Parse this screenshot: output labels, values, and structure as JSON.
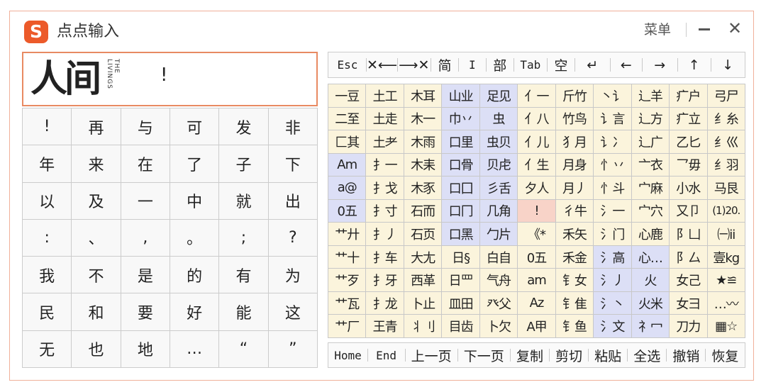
{
  "app": {
    "title": "点点输入",
    "logo": "S",
    "menu_label": "菜单",
    "minimize_label": "–",
    "close_label": "✕"
  },
  "preview": {
    "brand_text": "人间",
    "brand_sub": "THE LIVINGS",
    "mark": "!"
  },
  "left_grid": [
    [
      "!",
      "再",
      "与",
      "可",
      "发",
      "非"
    ],
    [
      "年",
      "来",
      "在",
      "了",
      "子",
      "下"
    ],
    [
      "以",
      "及",
      "一",
      "中",
      "就",
      "出"
    ],
    [
      ":",
      "、",
      ",",
      "。",
      ";",
      "?"
    ],
    [
      "我",
      "不",
      "是",
      "的",
      "有",
      "为"
    ],
    [
      "民",
      "和",
      "要",
      "好",
      "能",
      "这"
    ],
    [
      "无",
      "也",
      "地",
      "…",
      "“",
      "”"
    ]
  ],
  "toolbar_top": [
    "Esc",
    "✕⟵",
    "⟶✕",
    "简",
    "I",
    "部",
    "Tab",
    "空",
    "↵",
    "←",
    "→",
    "↑",
    "↓"
  ],
  "toolbar_bottom": [
    "Home",
    "End",
    "上一页",
    "下一页",
    "复制",
    "剪切",
    "粘贴",
    "全选",
    "撤销",
    "恢复"
  ],
  "right_grid": {
    "cells": [
      [
        "一豆",
        "土工",
        "木耳",
        "山业",
        "足见",
        "亻一",
        "斤竹",
        "丶讠",
        "辶羊",
        "疒户",
        "弓尸"
      ],
      [
        "二至",
        "土走",
        "木一",
        "巾丷",
        "虫",
        "亻八",
        "竹鸟",
        "讠言",
        "辶方",
        "疒立",
        "纟糸"
      ],
      [
        "匚其",
        "土耂",
        "木雨",
        "口里",
        "虫贝",
        "亻儿",
        "犭月",
        "讠冫",
        "辶广",
        "乙匕",
        "纟巛"
      ],
      [
        "Am",
        "扌一",
        "木耒",
        "口骨",
        "贝虍",
        "亻生",
        "月身",
        "忄丷",
        "亠衣",
        "乛毋",
        "纟羽"
      ],
      [
        "a@",
        "扌戈",
        "木豕",
        "口囗",
        "彡舌",
        "夕人",
        "月丿",
        "忄斗",
        "宀麻",
        "小水",
        "马艮"
      ],
      [
        "0五",
        "扌寸",
        "石而",
        "口冂",
        "几角",
        "!",
        "彳牛",
        "氵一",
        "宀穴",
        "又卩",
        "(1)20."
      ],
      [
        "艹廾",
        "扌丿",
        "石页",
        "口黑",
        "勹片",
        "《*",
        "禾矢",
        "氵门",
        "心鹿",
        "阝凵",
        "㈠ii"
      ],
      [
        "艹十",
        "扌车",
        "大尢",
        "日§",
        "白自",
        "0五",
        "禾金",
        "氵高",
        "心…",
        "阝厶",
        "壹kg"
      ],
      [
        "艹歹",
        "扌牙",
        "西革",
        "日罒",
        "气舟",
        "am",
        "钅女",
        "氵丿",
        "火",
        "女己",
        "★≌"
      ],
      [
        "艹瓦",
        "扌龙",
        "卜止",
        "皿田",
        "癶父",
        "Az",
        "钅隹",
        "氵丶",
        "火米",
        "女彐",
        "…〰"
      ],
      [
        "艹厂",
        "王青",
        "丬刂",
        "目齿",
        "卜欠",
        "A甲",
        "钅鱼",
        "氵文",
        "礻冖",
        "刀力",
        "▦☆"
      ]
    ],
    "tones": [
      "yyybbyyyyyy",
      "yyybbyyyyyy",
      "yyybbyyyyyy",
      "byybbyyyyyy",
      "byybbyyyyyy",
      "byybbyyyyyy",
      "yyybbyyyyyy",
      "yyyyyyybbyy",
      "yyyyyyybbyy",
      "yyyyyyybbyy",
      "yyyyyyybbyy"
    ],
    "colors": {
      "cream": "#fbf4dc",
      "lavender": "#dcdff6",
      "highlight": "#f8d3c8"
    }
  },
  "colors": {
    "accent": "#ec5a2a",
    "border": "#e88a62"
  }
}
